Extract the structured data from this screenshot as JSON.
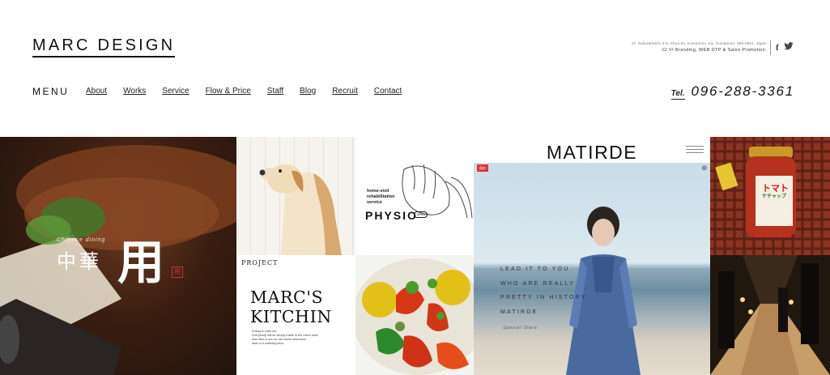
{
  "site": {
    "logo": "MARC DESIGN",
    "address": "1F. Sakuramachi 5-9, Chuo-ku, Kumamoto city, Kumamoto. 860-0841. Japan",
    "tagline": "CI VI Branding, WEB DTP & Sales Promotion.",
    "social": [
      {
        "icon": "facebook-icon",
        "glyph": "f"
      },
      {
        "icon": "twitter-icon",
        "glyph": ""
      }
    ]
  },
  "nav": {
    "label": "MENU",
    "items": [
      {
        "label": "About"
      },
      {
        "label": "Works"
      },
      {
        "label": "Service"
      },
      {
        "label": "Flow & Price"
      },
      {
        "label": "Staff"
      },
      {
        "label": "Blog"
      },
      {
        "label": "Recruit"
      },
      {
        "label": "Contact"
      }
    ]
  },
  "contact": {
    "tel_label": "Tel.",
    "tel_number": "096-288-3361"
  },
  "works": {
    "chinese": {
      "subtitle": "Chinese dining",
      "title": "中華",
      "mark": "用",
      "seal": "用"
    },
    "physio": {
      "line1": "home-visit",
      "line2": "rehabilitation",
      "line3": "service",
      "logo": "PHYSIO",
      "badge": "JAPAN"
    },
    "marc_kitchen": {
      "project": "PROJECT",
      "title_line1": "MARC'S",
      "title_line2": "KITCHIN",
      "desc_line1": "Eating is nutrit ion.",
      "desc_line2": "Everybody will be simply made in the reach dolls",
      "desc_line3": "lean dlirs to you so her sweet deliciouss",
      "desc_line4": "dishi in a soething liece."
    },
    "matirde": {
      "brand": "MATIRDE",
      "badge": "保存",
      "copy_line1": "LEAD IT TO YOU",
      "copy_line2": "WHO ARE REALLY",
      "copy_line3": "PRETTY IN HISTORY",
      "copy_line4": "MATIRDE",
      "signature": "Special Store"
    },
    "ketchup": {
      "label1": "トマト",
      "label2": "ケチャップ"
    }
  },
  "colors": {
    "text": "#222222",
    "accent_red": "#d33333",
    "background": "#ffffff"
  }
}
